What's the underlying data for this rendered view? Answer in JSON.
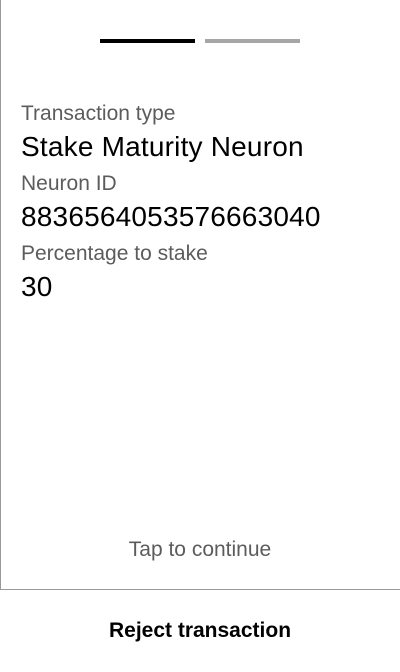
{
  "pager": {
    "current_page": 1,
    "total_pages": 2,
    "active_color": "#000000",
    "inactive_color": "#a6a6a6"
  },
  "fields": [
    {
      "label": "Transaction type",
      "value": "Stake Maturity Neuron"
    },
    {
      "label": "Neuron ID",
      "value": "8836564053576663040"
    },
    {
      "label": "Percentage to stake",
      "value": "30"
    }
  ],
  "tap_hint": "Tap to continue",
  "reject_label": "Reject transaction"
}
